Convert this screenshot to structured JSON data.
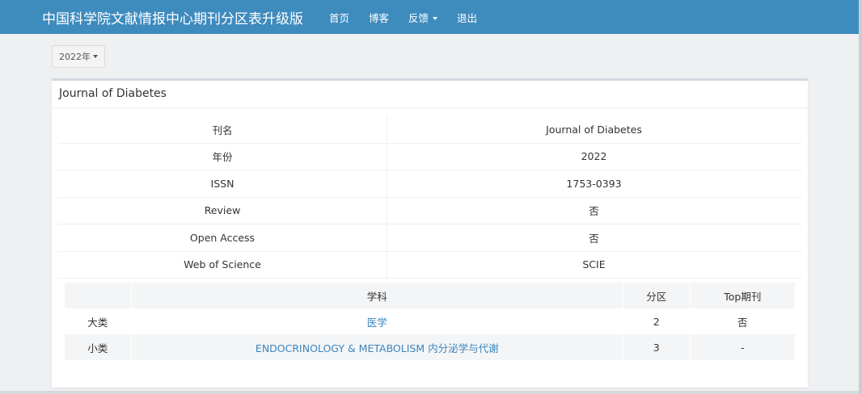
{
  "navbar": {
    "brand": "中国科学院文献情报中心期刊分区表升级版",
    "items": [
      "首页",
      "博客",
      "反馈",
      "退出"
    ]
  },
  "year_selector": {
    "label": "2022年"
  },
  "panel": {
    "title": "Journal of Diabetes"
  },
  "journal_info": [
    {
      "label": "刊名",
      "value": "Journal of Diabetes"
    },
    {
      "label": "年份",
      "value": "2022"
    },
    {
      "label": "ISSN",
      "value": "1753-0393"
    },
    {
      "label": "Review",
      "value": "否"
    },
    {
      "label": "Open Access",
      "value": "否"
    },
    {
      "label": "Web of Science",
      "value": "SCIE"
    }
  ],
  "subject_table": {
    "headers": [
      "",
      "学科",
      "分区",
      "Top期刊"
    ],
    "rows": [
      {
        "category": "大类",
        "subject": "医学",
        "zone": "2",
        "top": "否"
      },
      {
        "category": "小类",
        "subject": "ENDOCRINOLOGY & METABOLISM 内分泌学与代谢",
        "zone": "3",
        "top": "-"
      }
    ]
  },
  "colors": {
    "navbar": "#3e8bbe",
    "link": "#3a85bf",
    "background": "#eef0f2"
  }
}
